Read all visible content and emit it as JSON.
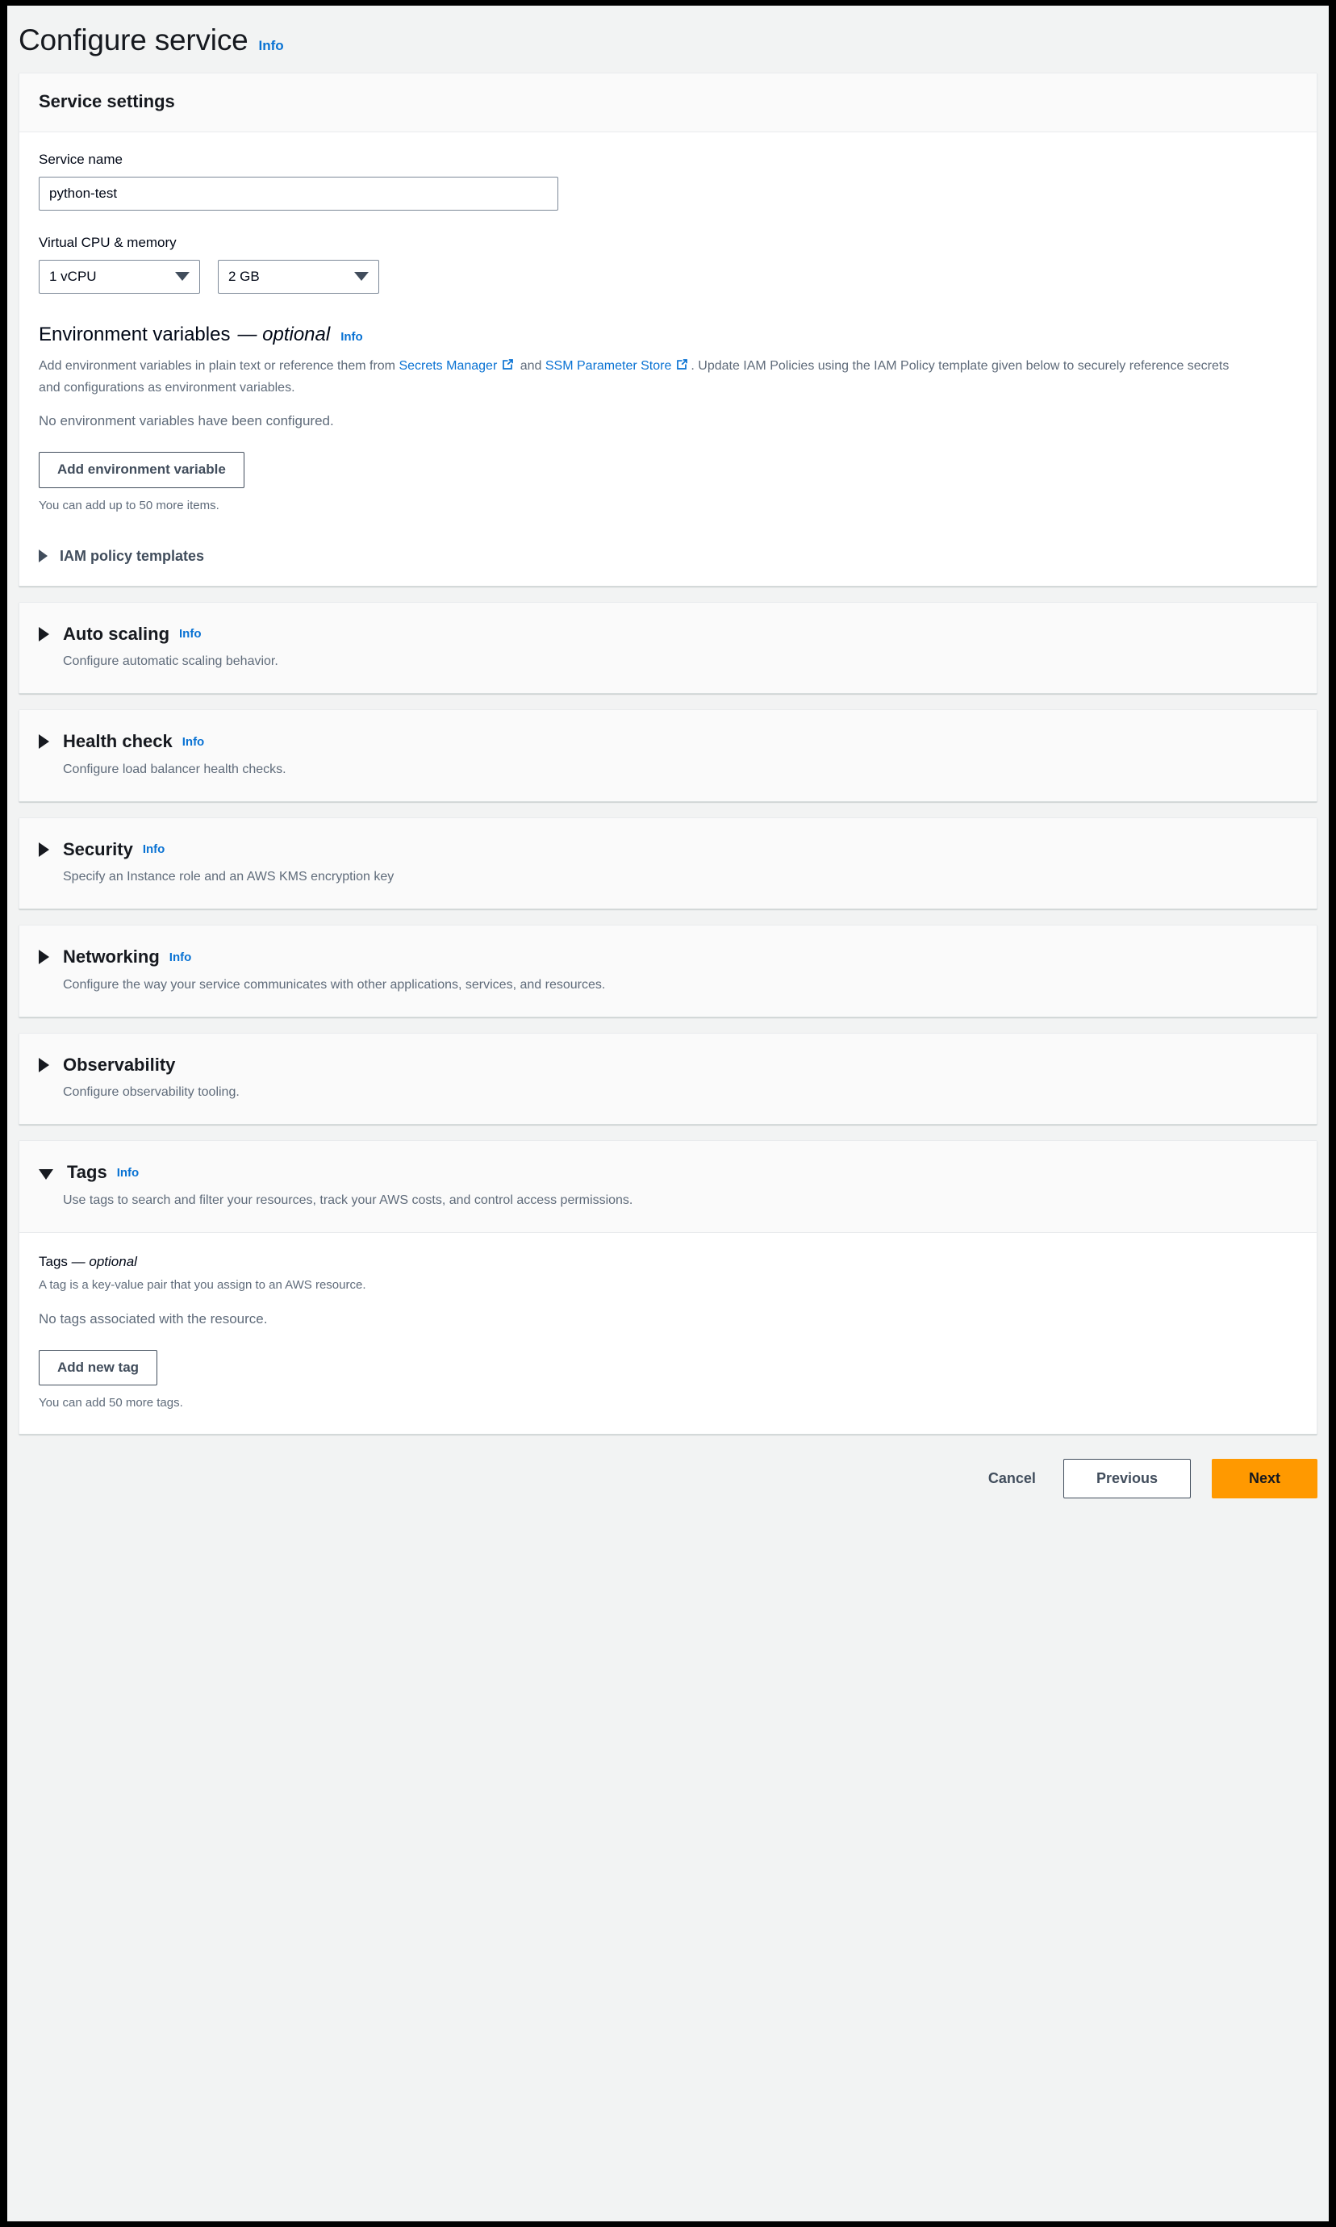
{
  "page": {
    "title": "Configure service",
    "info_label": "Info"
  },
  "service_settings": {
    "heading": "Service settings",
    "service_name": {
      "label": "Service name",
      "value": "python-test"
    },
    "cpu_memory": {
      "label": "Virtual CPU & memory",
      "cpu_value": "1 vCPU",
      "memory_value": "2 GB"
    },
    "env_vars": {
      "title": "Environment variables",
      "optional_suffix": "— optional",
      "info_label": "Info",
      "desc_part1": "Add environment variables in plain text or reference them from ",
      "link1": "Secrets Manager",
      "desc_part2": " and ",
      "link2": "SSM Parameter Store",
      "desc_part3": ". Update IAM Policies using the IAM Policy template given below to securely reference secrets and configurations as environment variables.",
      "empty_state": "No environment variables have been configured.",
      "add_button": "Add environment variable",
      "limit_note": "You can add up to 50 more items.",
      "iam_templates_label": "IAM policy templates"
    }
  },
  "sections": [
    {
      "id": "auto-scaling",
      "title": "Auto scaling",
      "info_label": "Info",
      "has_info": true,
      "description": "Configure automatic scaling behavior.",
      "expanded": false
    },
    {
      "id": "health-check",
      "title": "Health check",
      "info_label": "Info",
      "has_info": true,
      "description": "Configure load balancer health checks.",
      "expanded": false
    },
    {
      "id": "security",
      "title": "Security",
      "info_label": "Info",
      "has_info": true,
      "description": "Specify an Instance role and an AWS KMS encryption key",
      "expanded": false
    },
    {
      "id": "networking",
      "title": "Networking",
      "info_label": "Info",
      "has_info": true,
      "description": "Configure the way your service communicates with other applications, services, and resources.",
      "expanded": false
    },
    {
      "id": "observability",
      "title": "Observability",
      "info_label": "",
      "has_info": false,
      "description": "Configure observability tooling.",
      "expanded": false
    },
    {
      "id": "tags",
      "title": "Tags",
      "info_label": "Info",
      "has_info": true,
      "description": "Use tags to search and filter your resources, track your AWS costs, and control access permissions.",
      "expanded": true
    }
  ],
  "tags_body": {
    "label": "Tags",
    "optional_suffix": "— optional",
    "description": "A tag is a key-value pair that you assign to an AWS resource.",
    "empty_state": "No tags associated with the resource.",
    "add_button": "Add new tag",
    "limit_note": "You can add 50 more tags."
  },
  "footer": {
    "cancel": "Cancel",
    "previous": "Previous",
    "next": "Next"
  },
  "colors": {
    "link": "#0972d3",
    "primary_button": "#ff9900",
    "page_background": "#f2f3f3",
    "card_header": "#fafafa",
    "text": "#16191f",
    "muted_text": "#5f6b7a"
  }
}
